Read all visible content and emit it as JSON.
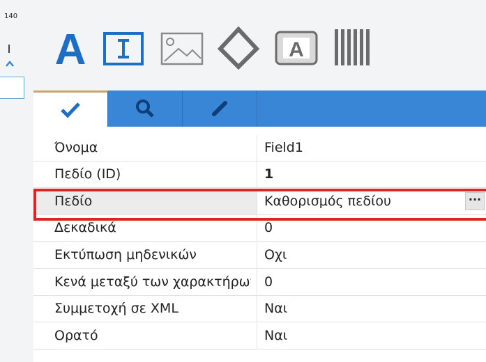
{
  "ruler": {
    "value": "140"
  },
  "toolbar": {
    "tools": [
      {
        "id": "text",
        "icon": "text-a-icon"
      },
      {
        "id": "textbox",
        "icon": "text-field-icon"
      },
      {
        "id": "image",
        "icon": "image-icon"
      },
      {
        "id": "shape",
        "icon": "diamond-icon"
      },
      {
        "id": "label",
        "icon": "boxed-a-icon"
      },
      {
        "id": "barcode",
        "icon": "barcode-icon"
      }
    ]
  },
  "tabs": [
    {
      "id": "properties",
      "icon": "checkmark-icon",
      "active": true
    },
    {
      "id": "search",
      "icon": "search-icon",
      "active": false
    },
    {
      "id": "edit",
      "icon": "pencil-icon",
      "active": false
    }
  ],
  "properties": {
    "rows": [
      {
        "name": "Όνομα",
        "value": "Field1"
      },
      {
        "name": "Πεδίο (ID)",
        "value": "1"
      },
      {
        "name": "Πεδίο",
        "value": "Καθορισμός πεδίου"
      },
      {
        "name": "Δεκαδικά",
        "value": "0"
      },
      {
        "name": "Εκτύπωση μηδενικών",
        "value": "Οχι"
      },
      {
        "name": "Κενά μεταξύ των χαρακτήρων",
        "value": "0"
      },
      {
        "name": "Συμμετοχή σε XML",
        "value": "Ναι"
      },
      {
        "name": "Ορατό",
        "value": "Ναι"
      }
    ],
    "ellipsis_label": "···"
  },
  "colors": {
    "accent": "#3a86d6",
    "icon_blue": "#1e6fc4",
    "icon_gray": "#6b6b6b",
    "highlight": "#e02424"
  }
}
